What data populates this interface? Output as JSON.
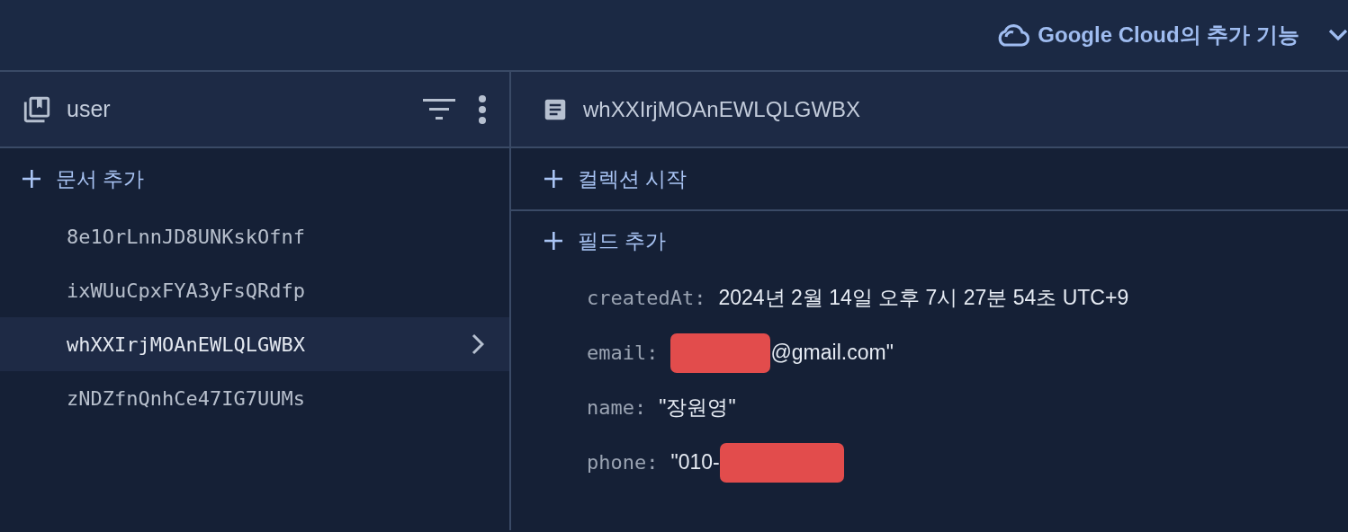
{
  "top_bar": {
    "extras_label": "Google Cloud의 추가 기능"
  },
  "collection_panel": {
    "title": "user",
    "add_label": "문서 추가",
    "documents": [
      {
        "id": "8e1OrLnnJD8UNKskOfnf",
        "selected": false
      },
      {
        "id": "ixWUuCpxFYA3yFsQRdfp",
        "selected": false
      },
      {
        "id": "whXXIrjMOAnEWLQLGWBX",
        "selected": true
      },
      {
        "id": "zNDZfnQnhCe47IG7UUMs",
        "selected": false
      }
    ]
  },
  "document_panel": {
    "title": "whXXIrjMOAnEWLQLGWBX",
    "start_collection_label": "컬렉션 시작",
    "add_field_label": "필드 추가",
    "fields": [
      {
        "key": "createdAt:",
        "value": "2024년 2월 14일 오후 7시 27분 54초 UTC+9"
      },
      {
        "key": "email:",
        "value": "@gmail.com\"",
        "masked_before": true
      },
      {
        "key": "name:",
        "value": "\"장원영\""
      },
      {
        "key": "phone:",
        "value": "\"010-",
        "masked_after": true
      }
    ]
  }
}
